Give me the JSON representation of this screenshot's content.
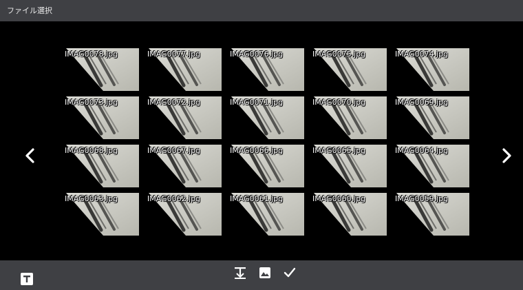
{
  "window": {
    "title": "ファイル選択"
  },
  "colors": {
    "titlebar": "#3f4044",
    "selection": "#1aa7ec",
    "background": "#000000"
  },
  "navigation": {
    "prev_icon": "chevron-left-icon",
    "next_icon": "chevron-right-icon"
  },
  "files": [
    {
      "name": "IMAG0078.jpg",
      "selected": true
    },
    {
      "name": "IMAG0077.jpg",
      "selected": false
    },
    {
      "name": "IMAG0076.jpg",
      "selected": false
    },
    {
      "name": "IMAG0075.jpg",
      "selected": false
    },
    {
      "name": "IMAG0074.jpg",
      "selected": false
    },
    {
      "name": "IMAG0073.jpg",
      "selected": false
    },
    {
      "name": "IMAG0072.jpg",
      "selected": false
    },
    {
      "name": "IMAG0071.jpg",
      "selected": false
    },
    {
      "name": "IMAG0070.jpg",
      "selected": false
    },
    {
      "name": "IMAG0069.jpg",
      "selected": false
    },
    {
      "name": "IMAG0068.jpg",
      "selected": false
    },
    {
      "name": "IMAG0067.jpg",
      "selected": false
    },
    {
      "name": "IMAG0066.jpg",
      "selected": false
    },
    {
      "name": "IMAG0065.jpg",
      "selected": false
    },
    {
      "name": "IMAG0064.jpg",
      "selected": false
    },
    {
      "name": "IMAG0063.jpg",
      "selected": false
    },
    {
      "name": "IMAG0062.jpg",
      "selected": false
    },
    {
      "name": "IMAG0061.jpg",
      "selected": false
    },
    {
      "name": "IMAG0060.jpg",
      "selected": false
    },
    {
      "name": "IMAG0059.jpg",
      "selected": false
    }
  ],
  "toolbar": {
    "left_icon": "text-format-icon",
    "items": [
      {
        "icon": "text-download-icon"
      },
      {
        "icon": "image-icon"
      },
      {
        "icon": "checkmark-icon"
      }
    ]
  }
}
